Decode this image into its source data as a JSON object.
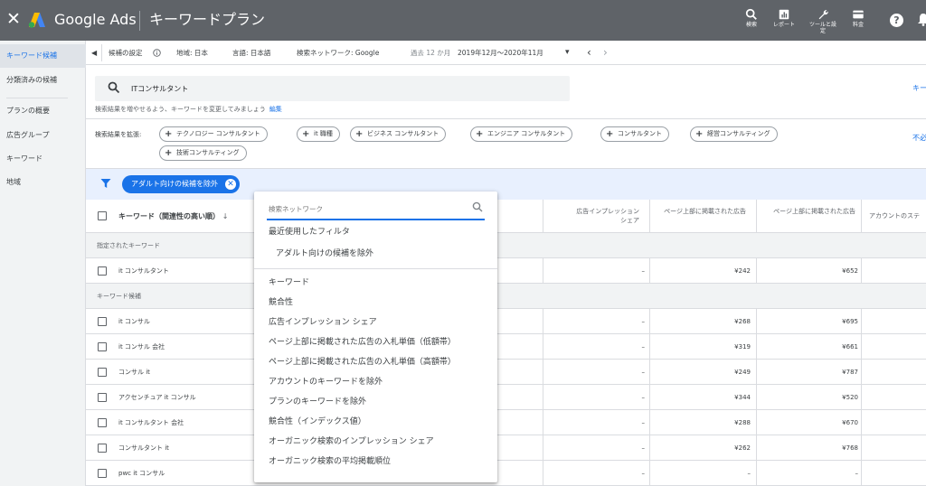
{
  "header": {
    "close_glyph": "✕",
    "brand": "Google Ads",
    "page_title": "キーワードプラン",
    "tools": [
      {
        "label": "検索",
        "icon": "search-icon"
      },
      {
        "label": "レポート",
        "icon": "report-icon"
      },
      {
        "label": "ツールと設定",
        "icon": "wrench-icon"
      },
      {
        "label": "料金",
        "icon": "billing-icon"
      }
    ],
    "help_glyph": "?"
  },
  "sidebar": {
    "items": [
      {
        "label": "キーワード候補",
        "active": true
      },
      {
        "label": "分類済みの候補",
        "active": false
      },
      {
        "label": "プランの概要",
        "active": false
      },
      {
        "label": "広告グループ",
        "active": false
      },
      {
        "label": "キーワード",
        "active": false
      },
      {
        "label": "地域",
        "active": false
      }
    ]
  },
  "targeting_bar": {
    "collapse_glyph": "◀",
    "settings_label": "候補の設定",
    "location": "地域: 日本",
    "language": "言語: 日本語",
    "network": "検索ネットワーク: Google",
    "period_label": "過去 12 か月",
    "period_value": "2019年12月〜2020年11月",
    "dropdown_glyph": "▾",
    "prev_glyph": "‹",
    "next_glyph": "›"
  },
  "search": {
    "value": "ITコンサルタント",
    "hint": "検索結果を増やせるよう、キーワードを変更してみましょう",
    "edit_link": "編集",
    "right_link": "キー"
  },
  "expand": {
    "label": "検索結果を拡張:",
    "chips": [
      "テクノロジー コンサルタント",
      "it 職種",
      "ビジネス コンサルタント",
      "エンジニア コンサルタント",
      "コンサルタント",
      "経営コンサルティング",
      "技術コンサルティング"
    ],
    "right_link": "不必"
  },
  "active_filter": {
    "label": "アダルト向けの候補を除外",
    "remove_glyph": "✕"
  },
  "table": {
    "headers": {
      "keyword": "キーワード（関連性の高い順）",
      "sort_glyph": "↓",
      "impression_share": "広告インプレッション\nシェア",
      "bid_low": "ページ上部に掲載された広告",
      "bid_high": "ページ上部に掲載された広告",
      "account_status": "アカウントのステ"
    },
    "section_specified": "指定されたキーワード",
    "specified_rows": [
      {
        "keyword": "it コンサルタント",
        "share": "–",
        "low": "¥242",
        "high": "¥652"
      }
    ],
    "section_ideas": "キーワード候補",
    "idea_rows": [
      {
        "keyword": "it コンサル",
        "share": "–",
        "low": "¥268",
        "high": "¥695"
      },
      {
        "keyword": "it コンサル 会社",
        "share": "–",
        "low": "¥319",
        "high": "¥661"
      },
      {
        "keyword": "コンサル it",
        "share": "–",
        "low": "¥249",
        "high": "¥787"
      },
      {
        "keyword": "アクセンチュア it コンサル",
        "share": "–",
        "low": "¥344",
        "high": "¥520"
      },
      {
        "keyword": "it コンサルタント 会社",
        "share": "–",
        "low": "¥288",
        "high": "¥670"
      },
      {
        "keyword": "コンサルタント it",
        "share": "–",
        "low": "¥262",
        "high": "¥768"
      },
      {
        "keyword": "pwc it コンサル",
        "share": "–",
        "low": "–",
        "high": "–"
      }
    ]
  },
  "dropdown": {
    "search_placeholder": "検索ネットワーク",
    "recent_title": "最近使用したフィルタ",
    "recent_items": [
      "アダルト向けの候補を除外"
    ],
    "options": [
      "キーワード",
      "競合性",
      "広告インプレッション シェア",
      "ページ上部に掲載された広告の入札単価（低額帯）",
      "ページ上部に掲載された広告の入札単価（高額帯）",
      "アカウントのキーワードを除外",
      "プランのキーワードを除外",
      "競合性（インデックス値）",
      "オーガニック検索のインプレッション シェア",
      "オーガニック検索の平均掲載順位"
    ]
  },
  "colors": {
    "topbar": "#5f6368",
    "accent": "#1a73e8",
    "sidebar_bg": "#f1f3f4",
    "filter_row_bg": "#e8f0fe"
  }
}
